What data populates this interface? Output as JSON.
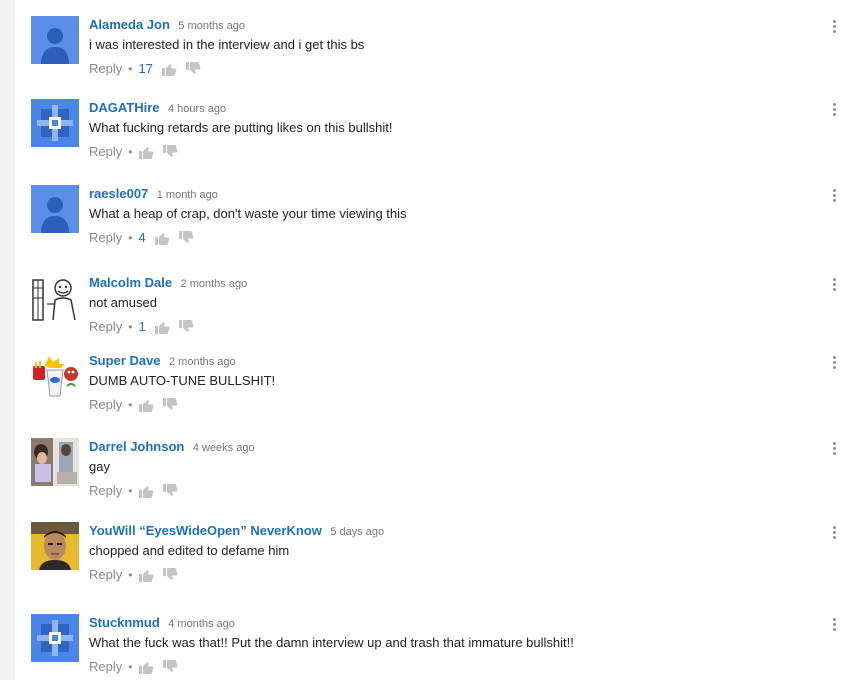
{
  "labels": {
    "reply": "Reply",
    "dot": "•"
  },
  "comments": [
    {
      "author": "Alameda Jon",
      "time": "5 months ago",
      "text": "i was interested in the interview and i get this bs",
      "likes": "17",
      "avatar": "default-person"
    },
    {
      "author": "DAGATHire",
      "time": "4 hours ago",
      "text": "What fucking retards are putting likes on this bullshit!",
      "likes": "",
      "avatar": "blue-cross-pattern"
    },
    {
      "author": "raesle007",
      "time": "1 month ago",
      "text": "What a heap of crap, don't waste your time viewing this",
      "likes": "4",
      "avatar": "default-person"
    },
    {
      "author": "Malcolm Dale",
      "time": "2 months ago",
      "text": "not amused",
      "likes": "1",
      "avatar": "sketch-cartoon"
    },
    {
      "author": "Super Dave",
      "time": "2 months ago",
      "text": "DUMB AUTO-TUNE BULLSHIT!",
      "likes": "",
      "avatar": "cartoon-characters"
    },
    {
      "author": "Darrel Johnson",
      "time": "4 weeks ago",
      "text": "gay",
      "likes": "",
      "avatar": "photo-thumbnail"
    },
    {
      "author": "YouWill “EyesWideOpen” NeverKnow",
      "time": "5 days ago",
      "text": "chopped and edited to defame him",
      "likes": "",
      "avatar": "face-photo"
    },
    {
      "author": "Stucknmud",
      "time": "4 months ago",
      "text": "What the fuck was that!! Put the damn interview up and trash that immature bullshit!!",
      "likes": "",
      "avatar": "blue-cross-pattern"
    }
  ],
  "colors": {
    "author": "#1e6fc2",
    "avatar_blue": "#4a86e8",
    "meta": "#767676"
  }
}
